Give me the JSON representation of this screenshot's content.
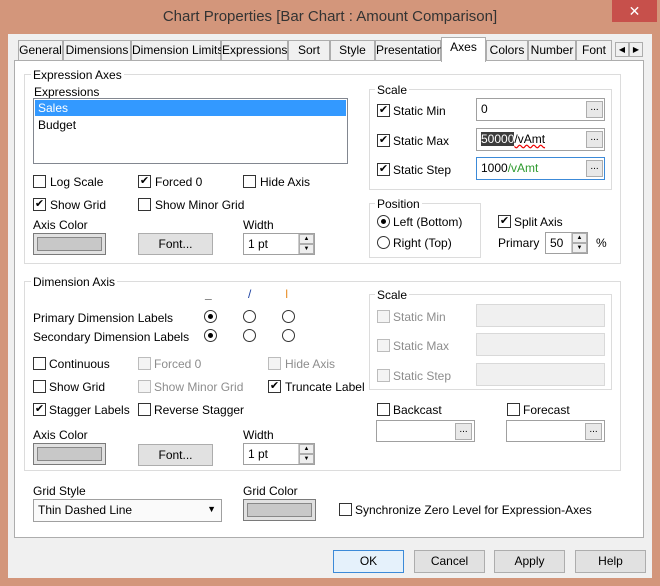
{
  "window": {
    "title": "Chart Properties [Bar Chart : Amount Comparison]",
    "close": "✕"
  },
  "tabs": [
    "General",
    "Dimensions",
    "Dimension Limits",
    "Expressions",
    "Sort",
    "Style",
    "Presentation",
    "Axes",
    "Colors",
    "Number",
    "Font"
  ],
  "active_tab": "Axes",
  "expr_axes": {
    "group": "Expression Axes",
    "list_label": "Expressions",
    "items": [
      "Sales",
      "Budget"
    ],
    "selected": "Sales",
    "log_scale": "Log Scale",
    "forced0": "Forced 0",
    "hide_axis": "Hide Axis",
    "show_grid": "Show Grid",
    "show_minor_grid": "Show Minor Grid",
    "axis_color": "Axis Color",
    "font": "Font...",
    "width_label": "Width",
    "width": "1 pt",
    "scale": {
      "group": "Scale",
      "static_min": "Static Min",
      "static_min_val": "0",
      "static_max": "Static Max",
      "static_max_sel": "50000",
      "static_max_rest": "/vAmt",
      "static_step": "Static Step",
      "static_step_num": "1000",
      "static_step_rest": "/vAmt"
    },
    "position": {
      "group": "Position",
      "left": "Left (Bottom)",
      "right": "Right (Top)"
    },
    "split_axis": "Split Axis",
    "primary": "Primary",
    "primary_val": "50",
    "pct": "%"
  },
  "dim_axis": {
    "group": "Dimension Axis",
    "primary_labels": "Primary Dimension Labels",
    "secondary_labels": "Secondary Dimension Labels",
    "orient_icons": [
      "_",
      "/",
      "I"
    ],
    "continuous": "Continuous",
    "forced0": "Forced 0",
    "hide_axis": "Hide Axis",
    "show_grid": "Show Grid",
    "show_minor_grid": "Show Minor Grid",
    "truncate": "Truncate Label",
    "stagger": "Stagger Labels",
    "reverse_stagger": "Reverse Stagger",
    "axis_color": "Axis Color",
    "font": "Font...",
    "width_label": "Width",
    "width": "1 pt",
    "scale": {
      "group": "Scale",
      "static_min": "Static Min",
      "static_max": "Static Max",
      "static_step": "Static Step"
    },
    "backcast": "Backcast",
    "forecast": "Forecast"
  },
  "grid_style": {
    "label": "Grid Style",
    "value": "Thin Dashed Line"
  },
  "grid_color": {
    "label": "Grid Color"
  },
  "sync_zero": "Synchronize Zero Level for Expression-Axes",
  "buttons": {
    "ok": "OK",
    "cancel": "Cancel",
    "apply": "Apply",
    "help": "Help"
  },
  "colors": {
    "titlebar": "#d3967b",
    "close": "#c7504b",
    "selection": "#3399ff",
    "expr_green": "#2e9a2e"
  }
}
